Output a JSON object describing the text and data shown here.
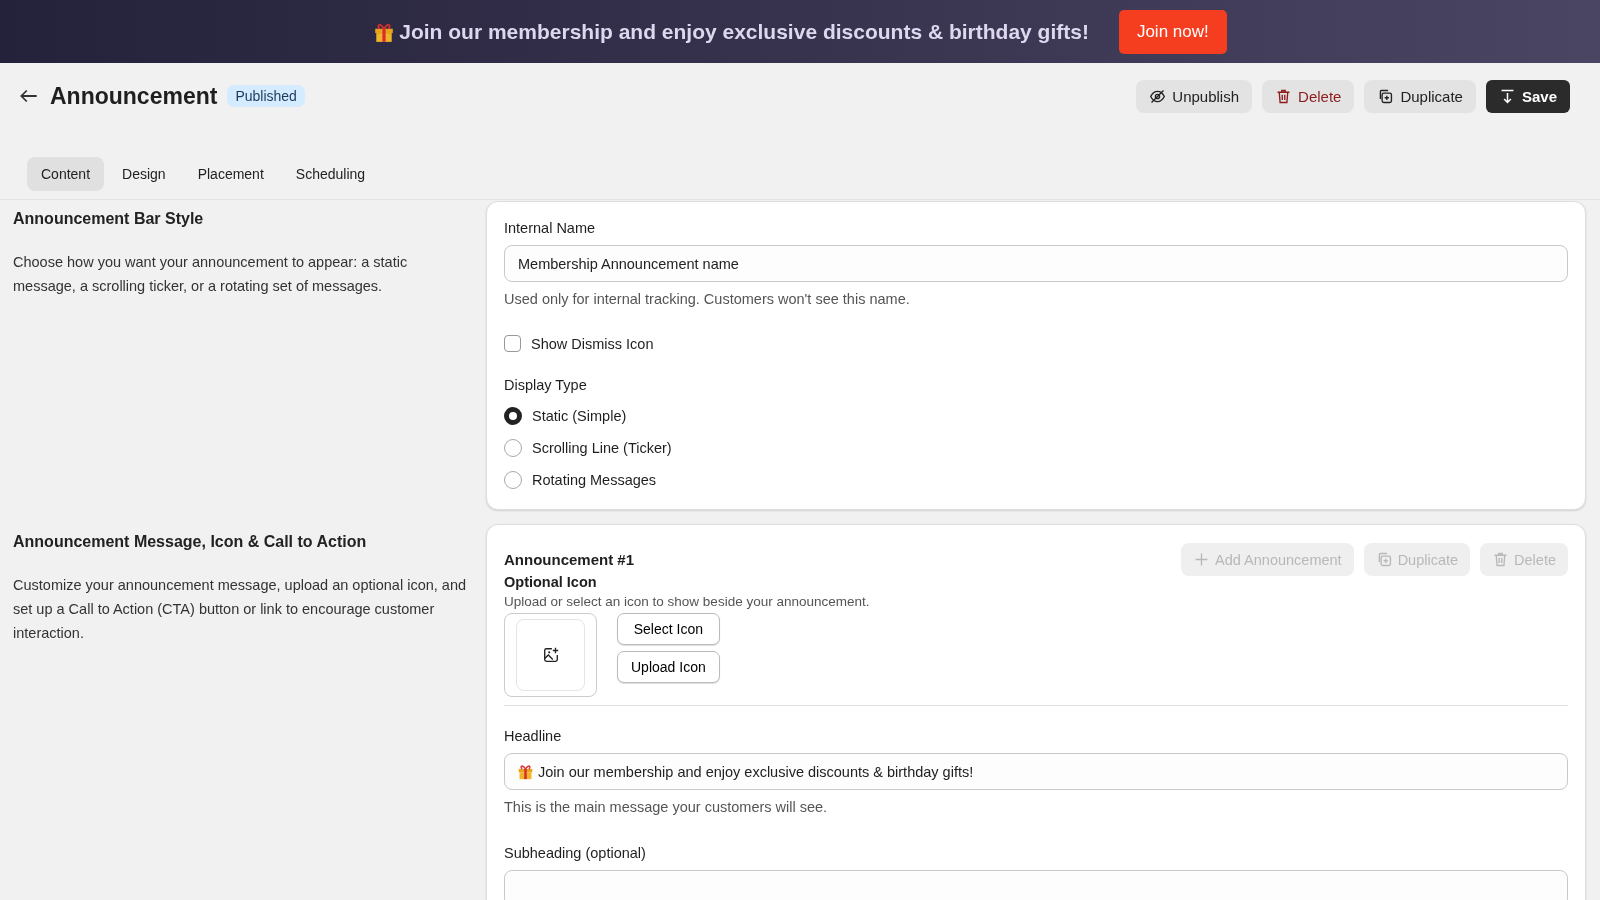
{
  "promo_banner": {
    "message": "Join our membership and enjoy exclusive discounts & birthday gifts!",
    "button": "Join now!"
  },
  "header": {
    "title": "Announcement",
    "status": "Published",
    "actions": [
      {
        "kind": "unpublish",
        "label": "Unpublish"
      },
      {
        "kind": "delete",
        "label": "Delete"
      },
      {
        "kind": "duplicate",
        "label": "Duplicate"
      },
      {
        "kind": "save",
        "label": "Save"
      }
    ]
  },
  "tabs": [
    {
      "label": "Content",
      "selected": true
    },
    {
      "label": "Design",
      "selected": false
    },
    {
      "label": "Placement",
      "selected": false
    },
    {
      "label": "Scheduling",
      "selected": false
    }
  ],
  "sections": [
    {
      "title": "Announcement Bar Style",
      "description": "Choose how you want your announcement to appear: a static message, a scrolling ticker, or a rotating set of messages."
    },
    {
      "title": "Announcement Message, Icon & Call to Action",
      "description": "Customize your announcement message, upload an optional icon, and set up a Call to Action (CTA) button or link to encourage customer interaction."
    }
  ],
  "style_card": {
    "internal_name": {
      "label": "Internal Name",
      "value": "Membership Announcement name",
      "help": "Used only for internal tracking. Customers won't see this name."
    },
    "dismiss": {
      "label": "Show Dismiss Icon",
      "checked": false
    },
    "display_type": {
      "label": "Display Type",
      "options": [
        {
          "label": "Static (Simple)",
          "selected": true
        },
        {
          "label": "Scrolling Line (Ticker)",
          "selected": false
        },
        {
          "label": "Rotating Messages",
          "selected": false
        }
      ]
    }
  },
  "message_card": {
    "title": "Announcement #1",
    "actions": [
      {
        "kind": "add",
        "label": "Add Announcement",
        "disabled": true
      },
      {
        "kind": "duplicate",
        "label": "Duplicate",
        "disabled": true
      },
      {
        "kind": "delete",
        "label": "Delete",
        "disabled": true
      }
    ],
    "icon": {
      "label": "Optional Icon",
      "help": "Upload or select an icon to show beside your announcement.",
      "buttons": [
        "Select Icon",
        "Upload Icon"
      ]
    },
    "headline": {
      "label": "Headline",
      "value": "Join our membership and enjoy exclusive discounts & birthday gifts!",
      "help": "This is the main message your customers will see."
    },
    "subheading": {
      "label": "Subheading (optional)"
    }
  }
}
